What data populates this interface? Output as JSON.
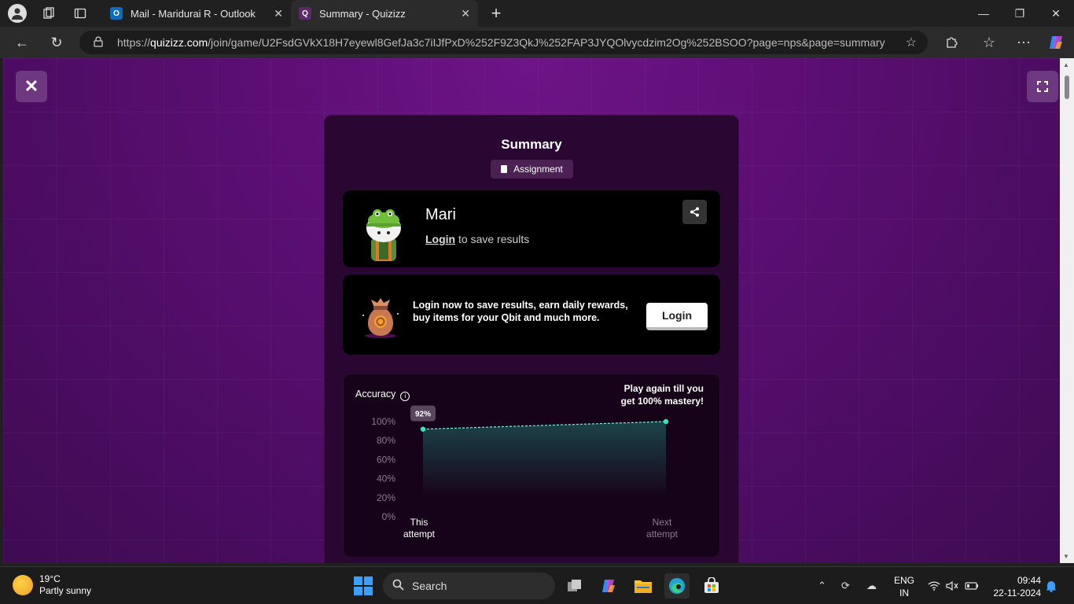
{
  "browser": {
    "tabs": [
      {
        "title": "Mail - Maridurai R - Outlook",
        "favicon": "outlook-icon"
      },
      {
        "title": "Summary - Quizizz",
        "favicon": "quizizz-icon",
        "active": true
      }
    ],
    "url_prefix": "https://",
    "url_domain": "quizizz.com",
    "url_path": "/join/game/U2FsdGVkX18H7eyewl8GefJa3c7iIJfPxD%252F9Z3QkJ%252FAP3JYQOlvycdzim2Og%252BSOO?page=nps&page=summary"
  },
  "summary": {
    "title": "Summary",
    "badge": "Assignment",
    "user": {
      "name": "Mari",
      "login_link": "Login",
      "login_suffix": " to save results"
    },
    "login_promo": {
      "message": "Login now to save results, earn daily rewards, buy items for your Qbit and much more.",
      "button": "Login"
    },
    "accuracy": {
      "label": "Accuracy",
      "play_again": "Play again till you get 100% mastery!"
    }
  },
  "chart_data": {
    "type": "line",
    "categories": [
      "This attempt",
      "Next attempt"
    ],
    "series": [
      {
        "values": [
          92,
          100
        ]
      }
    ],
    "data_labels": [
      "92%"
    ],
    "ylim": [
      0,
      100
    ],
    "yticks": [
      "100%",
      "80%",
      "60%",
      "40%",
      "20%",
      "0%"
    ],
    "colors": {
      "line": "#7ff2d8",
      "point": "#2ee8b8",
      "fill": "#1d4a4e"
    }
  },
  "taskbar": {
    "weather_temp": "19°C",
    "weather_desc": "Partly sunny",
    "search_placeholder": "Search",
    "lang_line1": "ENG",
    "lang_line2": "IN",
    "time": "09:44",
    "date": "22-11-2024"
  }
}
